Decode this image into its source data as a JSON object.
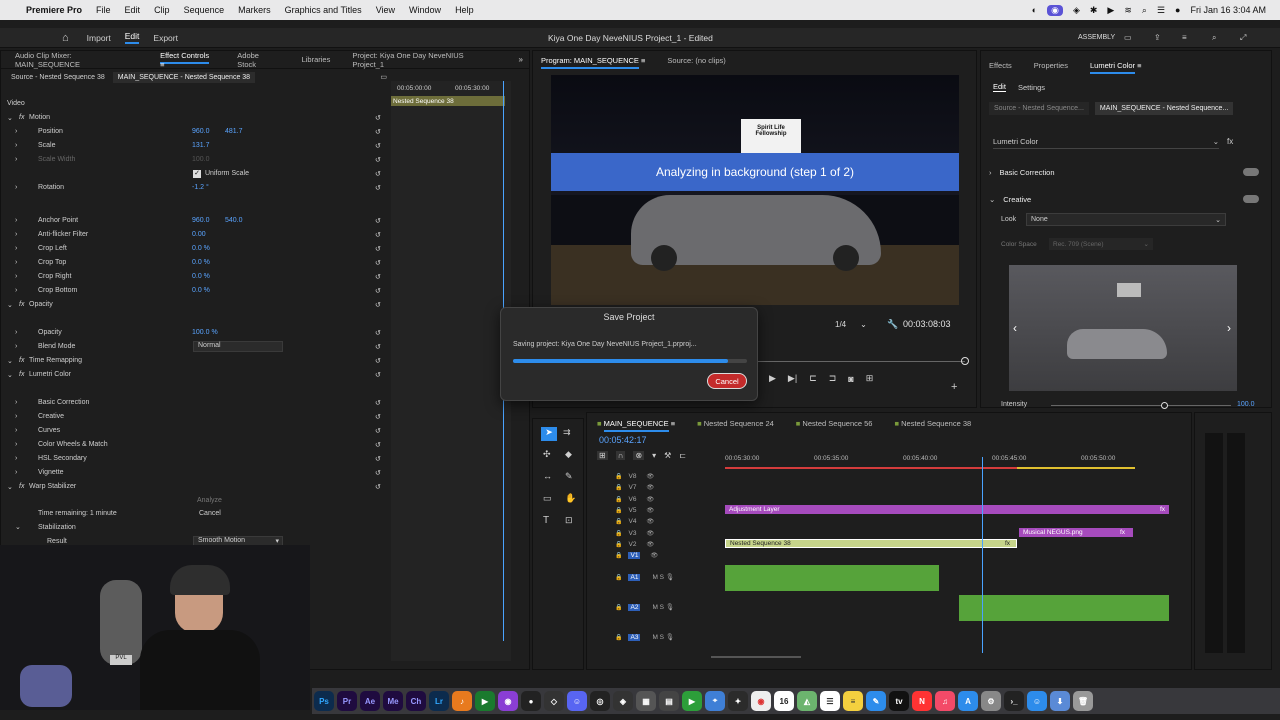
{
  "menubar": {
    "app": "Premiere Pro",
    "items": [
      "File",
      "Edit",
      "Clip",
      "Sequence",
      "Markers",
      "Graphics and Titles",
      "View",
      "Window",
      "Help"
    ],
    "clock": "Fri Jan 16  3:04 AM"
  },
  "workspace": {
    "tabs": [
      "Import",
      "Edit",
      "Export"
    ],
    "project_title": "Kiya One Day NeveNIUS Project_1 - Edited",
    "workspace_name": "ASSEMBLY"
  },
  "left_panel": {
    "tabs": [
      "Audio Clip Mixer: MAIN_SEQUENCE",
      "Effect Controls",
      "Adobe Stock",
      "Libraries",
      "Project: Kiya One Day NeveNIUS Project_1"
    ],
    "source_tab": "Source - Nested Sequence 38",
    "sequence_tab": "MAIN_SEQUENCE - Nested Sequence 38",
    "timecodes": [
      "00:05:00:00",
      "00:05:30:00"
    ],
    "clip_label": "Nested Sequence 38",
    "video_header": "Video",
    "rows": [
      {
        "label": "Motion",
        "indent": 1,
        "fx": true
      },
      {
        "label": "Position",
        "indent": 2,
        "v1": "960.0",
        "v2": "481.7"
      },
      {
        "label": "Scale",
        "indent": 2,
        "v1": "131.7",
        "v2": ""
      },
      {
        "label": "Scale Width",
        "indent": 2,
        "v1": "100.0",
        "v2": "",
        "dim": true
      },
      {
        "label": "Uniform Scale",
        "indent": 3,
        "check": true
      },
      {
        "label": "Rotation",
        "indent": 2,
        "v1": "-1.2 °",
        "v2": ""
      },
      {
        "label": "Anchor Point",
        "indent": 2,
        "v1": "960.0",
        "v2": "540.0"
      },
      {
        "label": "Anti-flicker Filter",
        "indent": 2,
        "v1": "0.00",
        "v2": ""
      },
      {
        "label": "Crop Left",
        "indent": 2,
        "v1": "0.0 %",
        "v2": ""
      },
      {
        "label": "Crop Top",
        "indent": 2,
        "v1": "0.0 %",
        "v2": ""
      },
      {
        "label": "Crop Right",
        "indent": 2,
        "v1": "0.0 %",
        "v2": ""
      },
      {
        "label": "Crop Bottom",
        "indent": 2,
        "v1": "0.0 %",
        "v2": ""
      },
      {
        "label": "Opacity",
        "indent": 1,
        "fx": true
      },
      {
        "label": "Opacity",
        "indent": 2,
        "v1": "100.0 %",
        "v2": ""
      },
      {
        "label": "Blend Mode",
        "indent": 2,
        "select": "Normal"
      },
      {
        "label": "Time Remapping",
        "indent": 1,
        "fx": true
      },
      {
        "label": "Lumetri Color",
        "indent": 1,
        "fx": true
      },
      {
        "label": "Basic Correction",
        "indent": 2
      },
      {
        "label": "Creative",
        "indent": 2
      },
      {
        "label": "Curves",
        "indent": 2
      },
      {
        "label": "Color Wheels & Match",
        "indent": 2
      },
      {
        "label": "HSL Secondary",
        "indent": 2
      },
      {
        "label": "Vignette",
        "indent": 2
      },
      {
        "label": "Warp Stabilizer",
        "indent": 1,
        "fx": true
      }
    ],
    "analyze_label": "Analyze",
    "time_remaining": "Time remaining: 1 minute",
    "cancel_label": "Cancel",
    "stabilization": "Stabilization",
    "result_label": "Result",
    "result_value": "Smooth Motion"
  },
  "program_monitor": {
    "tab": "Program: MAIN_SEQUENCE",
    "source_tab": "Source: (no clips)",
    "banner": "Analyzing in background (step 1 of 2)",
    "sign_text": "Spirit Life Fellowship",
    "fraction": "1/4",
    "timecode": "00:03:08:03"
  },
  "save_dialog": {
    "title": "Save Project",
    "message": "Saving project: Kiya One Day NeveNIUS Project_1.prproj...",
    "progress": 0.92,
    "cancel": "Cancel"
  },
  "lumetri": {
    "tabs": [
      "Effects",
      "Properties",
      "Lumetri Color"
    ],
    "subtabs": [
      "Edit",
      "Settings"
    ],
    "source_chip": "Source - Nested Sequence...",
    "seq_chip": "MAIN_SEQUENCE - Nested Sequence...",
    "effect_select": "Lumetri Color",
    "sections": [
      "Basic Correction",
      "Creative"
    ],
    "look_label": "Look",
    "look_value": "None",
    "colorspace_label": "Color Space",
    "colorspace_value": "Rec. 709 (Scene)",
    "intensity_label": "Intensity",
    "intensity_value": "100.0",
    "intensity": 1.0
  },
  "timeline": {
    "tabs": [
      "MAIN_SEQUENCE",
      "Nested Sequence 24",
      "Nested Sequence 56",
      "Nested Sequence 38"
    ],
    "timecode": "00:05:42:17",
    "ruler": [
      "00:05:30:00",
      "00:05:35:00",
      "00:05:40:00",
      "00:05:45:00",
      "00:05:50:00"
    ],
    "video_tracks": [
      "V8",
      "V7",
      "V6",
      "V5",
      "V4",
      "V3",
      "V2",
      "V1"
    ],
    "audio_tracks": [
      "A1",
      "A2",
      "A3"
    ],
    "clips": {
      "adjustment": "Adjustment Layer",
      "musical": "Musical NEGUS.png",
      "nested": "Nested Sequence 38"
    }
  },
  "webcam": {
    "shirt_text": "PVL"
  },
  "colors": {
    "accent": "#2d8ceb",
    "adjustment": "#a64bbd",
    "nested": "#c6d48a",
    "audio": "#56a33a",
    "banner": "#3a67c9",
    "dialog_button": "#c42b2b",
    "playhead": "#4aa3ff"
  }
}
